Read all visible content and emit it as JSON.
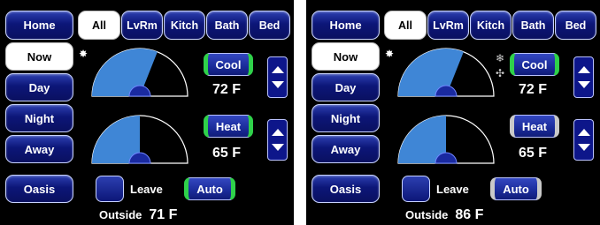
{
  "panels": [
    {
      "tabs": [
        "Home",
        "All",
        "LvRm",
        "Kitch",
        "Bath",
        "Bed"
      ],
      "selected_tab": "All",
      "modes": [
        "Now",
        "Day",
        "Night",
        "Away"
      ],
      "selected_mode": "Now",
      "oasis_label": "Oasis",
      "cool": {
        "label": "Cool",
        "temp": "72 F",
        "active": true,
        "gauge_fraction": 0.62
      },
      "heat": {
        "label": "Heat",
        "temp": "65 F",
        "active": true,
        "gauge_fraction": 0.5
      },
      "leave_label": "Leave",
      "auto_label": "Auto",
      "auto_active": true,
      "outside_label": "Outside",
      "outside_temp": "71 F",
      "icons": [
        "sun-icon"
      ]
    },
    {
      "tabs": [
        "Home",
        "All",
        "LvRm",
        "Kitch",
        "Bath",
        "Bed"
      ],
      "selected_tab": "All",
      "modes": [
        "Now",
        "Day",
        "Night",
        "Away"
      ],
      "selected_mode": "Now",
      "oasis_label": "Oasis",
      "cool": {
        "label": "Cool",
        "temp": "72 F",
        "active": true,
        "gauge_fraction": 0.62
      },
      "heat": {
        "label": "Heat",
        "temp": "65 F",
        "active": false,
        "gauge_fraction": 0.5
      },
      "leave_label": "Leave",
      "auto_label": "Auto",
      "auto_active": false,
      "outside_label": "Outside",
      "outside_temp": "86 F",
      "icons": [
        "sun-icon",
        "snowflake-icon",
        "fan-icon"
      ]
    }
  ],
  "colors": {
    "panel_bg": "#000000",
    "button_blue": "#0c1678",
    "gauge_fill": "#3f86d6",
    "active_green": "#2fd14a",
    "inactive_grey": "#c9c9c9"
  }
}
